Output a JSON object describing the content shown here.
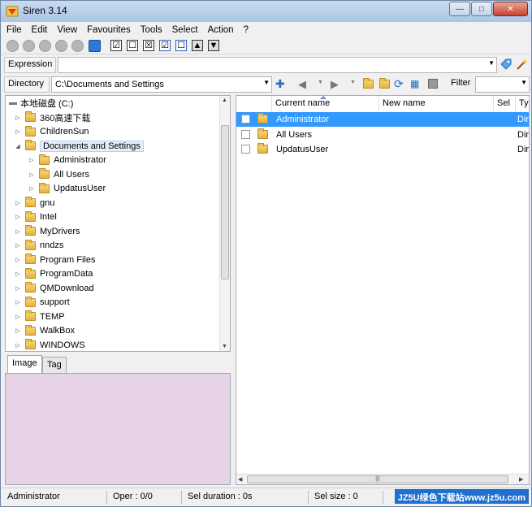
{
  "window": {
    "title": "Siren 3.14",
    "controls": {
      "minimize": "—",
      "maximize": "□",
      "close": "✕"
    }
  },
  "menu": [
    "File",
    "Edit",
    "View",
    "Favourites",
    "Tools",
    "Select",
    "Action",
    "?"
  ],
  "toolbar": {
    "icons": [
      "play-icon",
      "gear-icon",
      "run-icon",
      "undo-icon",
      "redo-icon",
      "monitor-icon"
    ],
    "checks": [
      "☑",
      "☐",
      "☒",
      "☑",
      "☐",
      "▲",
      "▼"
    ]
  },
  "expression": {
    "label": "Expression",
    "value": ""
  },
  "directory": {
    "label": "Directory",
    "value": "C:\\Documents and Settings"
  },
  "filter": {
    "label": "Filter",
    "value": ""
  },
  "tree": {
    "root": "本地磁盘 (C:)",
    "items": [
      {
        "label": "360高速下载",
        "level": 1,
        "expanded": false
      },
      {
        "label": "ChildrenSun",
        "level": 1,
        "expanded": false
      },
      {
        "label": "Documents and Settings",
        "level": 1,
        "expanded": true,
        "selected": true
      },
      {
        "label": "Administrator",
        "level": 2,
        "expanded": false
      },
      {
        "label": "All Users",
        "level": 2,
        "expanded": false
      },
      {
        "label": "UpdatusUser",
        "level": 2,
        "expanded": false
      },
      {
        "label": "gnu",
        "level": 1,
        "expanded": false
      },
      {
        "label": "Intel",
        "level": 1,
        "expanded": false
      },
      {
        "label": "MyDrivers",
        "level": 1,
        "expanded": false
      },
      {
        "label": "nndzs",
        "level": 1,
        "expanded": false
      },
      {
        "label": "Program Files",
        "level": 1,
        "expanded": false
      },
      {
        "label": "ProgramData",
        "level": 1,
        "expanded": false
      },
      {
        "label": "QMDownload",
        "level": 1,
        "expanded": false
      },
      {
        "label": "support",
        "level": 1,
        "expanded": false
      },
      {
        "label": "TEMP",
        "level": 1,
        "expanded": false
      },
      {
        "label": "WalkBox",
        "level": 1,
        "expanded": false
      },
      {
        "label": "WINDOWS",
        "level": 1,
        "expanded": false
      }
    ]
  },
  "tabs": [
    "Image",
    "Tag"
  ],
  "filelist": {
    "columns": [
      "Current name",
      "New name",
      "Sel",
      "Typ"
    ],
    "rows": [
      {
        "name": "Administrator",
        "type": "Dir",
        "selected": true
      },
      {
        "name": "All Users",
        "type": "Dir",
        "selected": false
      },
      {
        "name": "UpdatusUser",
        "type": "Dir",
        "selected": false
      }
    ]
  },
  "status": {
    "current": "Administrator",
    "oper": "Oper : 0/0",
    "sel_duration": "Sel duration : 0s",
    "sel_size": "Sel size : 0",
    "watermark": "JZ5U绿色下载站www.jz5u.com"
  }
}
